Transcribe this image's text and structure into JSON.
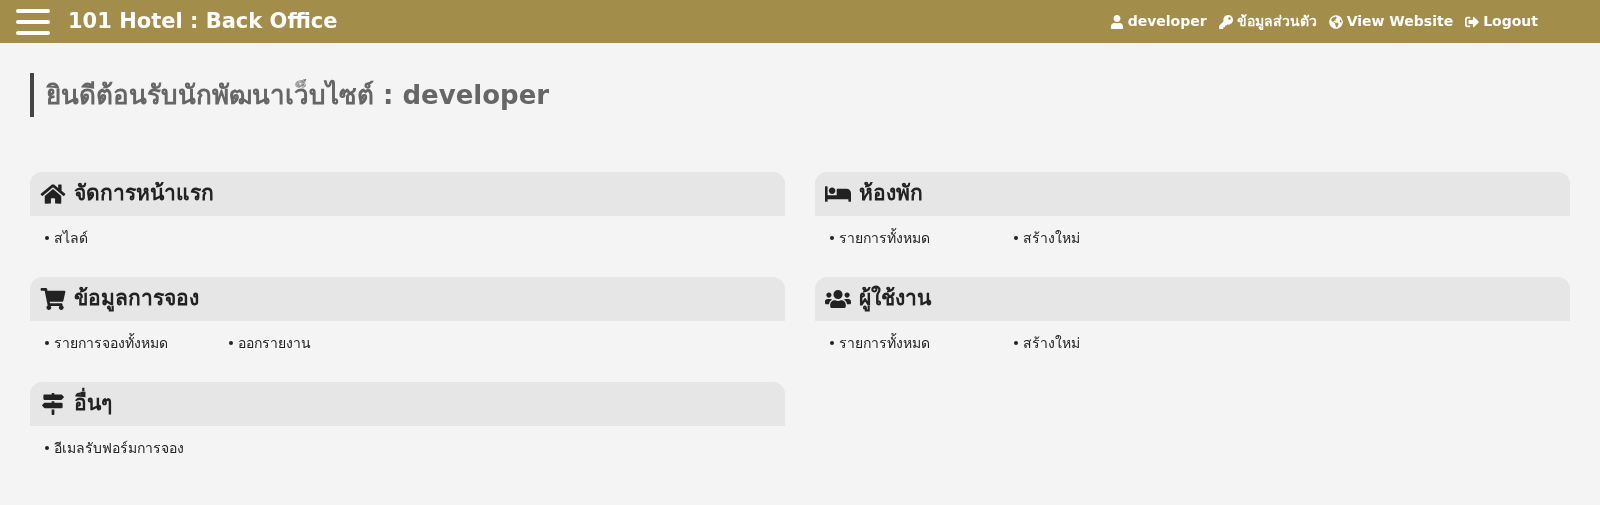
{
  "header": {
    "title": "101 Hotel : Back Office",
    "links": [
      {
        "kind": "user",
        "label": "developer"
      },
      {
        "kind": "key",
        "label": "ข้อมูลส่วนตัว"
      },
      {
        "kind": "globe",
        "label": "View Website"
      },
      {
        "kind": "logout",
        "label": "Logout"
      }
    ]
  },
  "welcome": "ยินดีต้อนรับนักพัฒนาเว็บไซต์ : developer",
  "columns": [
    [
      {
        "kind": "home",
        "title": "จัดการหน้าแรก",
        "items": [
          "สไลด์"
        ]
      },
      {
        "kind": "cart",
        "title": "ข้อมูลการจอง",
        "items": [
          "รายการจองทั้งหมด",
          "ออกรายงาน"
        ]
      },
      {
        "kind": "sign",
        "title": "อื่นๆ",
        "items": [
          "อีเมลรับฟอร์มการจอง"
        ]
      }
    ],
    [
      {
        "kind": "bed",
        "title": "ห้องพัก",
        "items": [
          "รายการทั้งหมด",
          "สร้างใหม่"
        ]
      },
      {
        "kind": "users",
        "title": "ผู้ใช้งาน",
        "items": [
          "รายการทั้งหมด",
          "สร้างใหม่"
        ]
      }
    ]
  ]
}
